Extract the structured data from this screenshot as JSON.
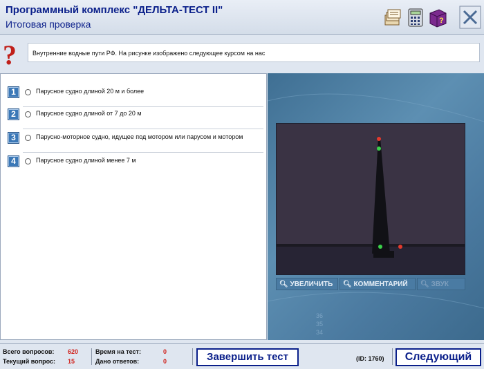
{
  "header": {
    "title": "Программный комплекс \"ДЕЛЬТА-ТЕСТ II\"",
    "subtitle": "Итоговая проверка"
  },
  "toolbar_icons": [
    "cards-icon",
    "calculator-icon",
    "help-book-icon",
    "close-icon"
  ],
  "question": {
    "text": "Внутренние водные пути РФ. На рисунке изображено следующее курсом на нас"
  },
  "answers": [
    {
      "num": "1",
      "text": "Парусное судно длиной 20 м и более"
    },
    {
      "num": "2",
      "text": "Парусное судно длиной от 7 до 20 м"
    },
    {
      "num": "3",
      "text": "Парусно-моторное судно, идущее под мотором или парусом и мотором"
    },
    {
      "num": "4",
      "text": "Парусное судно длиной менее 7 м"
    }
  ],
  "image_tools": {
    "zoom": "УВЕЛИЧИТЬ",
    "comment": "КОММЕНТАРИЙ",
    "sound": "ЗВУК"
  },
  "footer": {
    "total_label": "Всего вопросов:",
    "total_value": "620",
    "current_label": "Текущий вопрос:",
    "current_value": "15",
    "time_label": "Время на тест:",
    "time_value": "0",
    "answered_label": "Дано ответов:",
    "answered_value": "0",
    "finish_button": "Завершить тест",
    "id_text": "(ID: 1760)",
    "next_button": "Следующий"
  },
  "colors": {
    "brand_blue": "#0a1f8a",
    "accent_red": "#d0201a",
    "panel_blue": "#4b7aa0"
  }
}
